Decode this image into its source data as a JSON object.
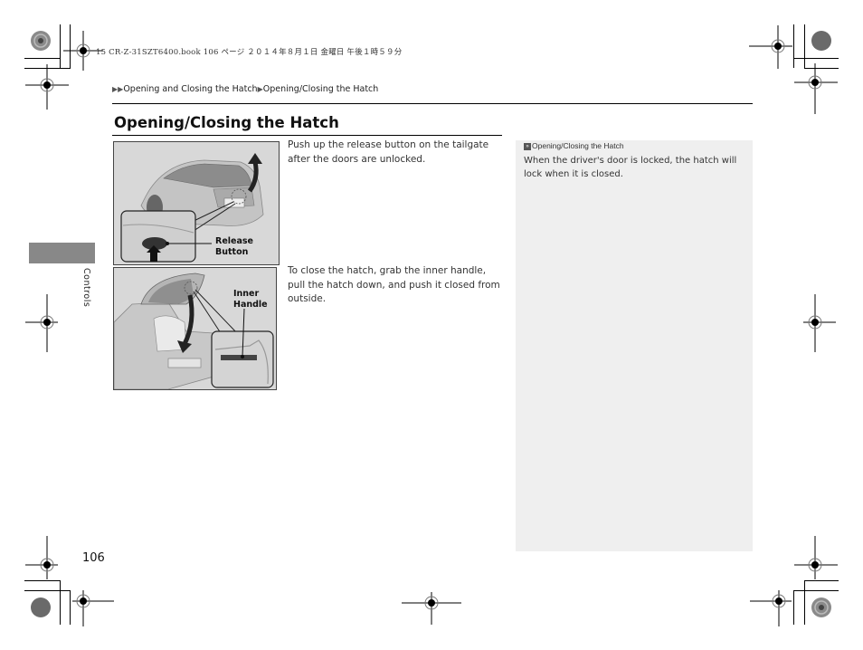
{
  "print_header": {
    "meta_text": "15 CR-Z-31SZT6400.book  106 ページ  ２０１４年８月１日  金曜日  午後１時５９分"
  },
  "breadcrumb": {
    "marker": "▶▶",
    "items": [
      "Opening and Closing the Hatch",
      "Opening/Closing the Hatch"
    ],
    "separator": "▶"
  },
  "section": {
    "title": "Opening/Closing the Hatch",
    "steps": [
      {
        "text": "Push up the release button on the tailgate after the doors are unlocked.",
        "figure_callout": "Release Button"
      },
      {
        "text": "To close the hatch, grab the inner handle, pull the hatch down, and push it closed from outside.",
        "figure_callout": "Inner Handle"
      }
    ]
  },
  "side_tab": {
    "label": "Controls",
    "color": "#888888"
  },
  "note": {
    "icon": "reference-icon",
    "title": "Opening/Closing the Hatch",
    "body": "When the driver's door is locked, the hatch will lock when it is closed.",
    "background": "#efefef"
  },
  "footer": {
    "page_number": "106"
  }
}
